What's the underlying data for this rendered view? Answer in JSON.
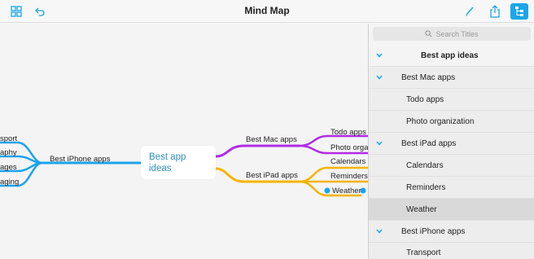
{
  "window": {
    "title": "Mind Map"
  },
  "toolbar": {
    "icons": [
      "grid-icon",
      "undo-icon",
      "pen-icon",
      "share-icon",
      "outline-icon"
    ],
    "accent_color": "#1aa6e8"
  },
  "canvas": {
    "central_node": "Best app ideas",
    "branches": [
      {
        "label": "Best Mac apps",
        "color": "#b12be6",
        "children": [
          "Todo apps",
          "Photo organization"
        ],
        "children_visible": [
          "Todo apps",
          "Photo orga"
        ]
      },
      {
        "label": "Best iPad apps",
        "color": "#f4b400",
        "children": [
          "Calendars",
          "Reminders",
          "Weather"
        ]
      },
      {
        "label": "Best iPhone apps",
        "color": "#1ba3ec",
        "children_visible": [
          "sport",
          "aphy",
          "ages",
          "aging"
        ]
      }
    ]
  },
  "outline": {
    "search_placeholder": "Search Titles",
    "rows": [
      {
        "label": "Best app ideas",
        "level": 0,
        "expanded": true,
        "bold": true
      },
      {
        "label": "Best Mac apps",
        "level": 1,
        "expanded": true
      },
      {
        "label": "Todo apps",
        "level": 2
      },
      {
        "label": "Photo organization",
        "level": 2
      },
      {
        "label": "Best iPad apps",
        "level": 1,
        "expanded": true
      },
      {
        "label": "Calendars",
        "level": 2
      },
      {
        "label": "Reminders",
        "level": 2
      },
      {
        "label": "Weather",
        "level": 2,
        "selected": true
      },
      {
        "label": "Best iPhone apps",
        "level": 1,
        "expanded": true
      },
      {
        "label": "Transport",
        "level": 2
      }
    ]
  }
}
